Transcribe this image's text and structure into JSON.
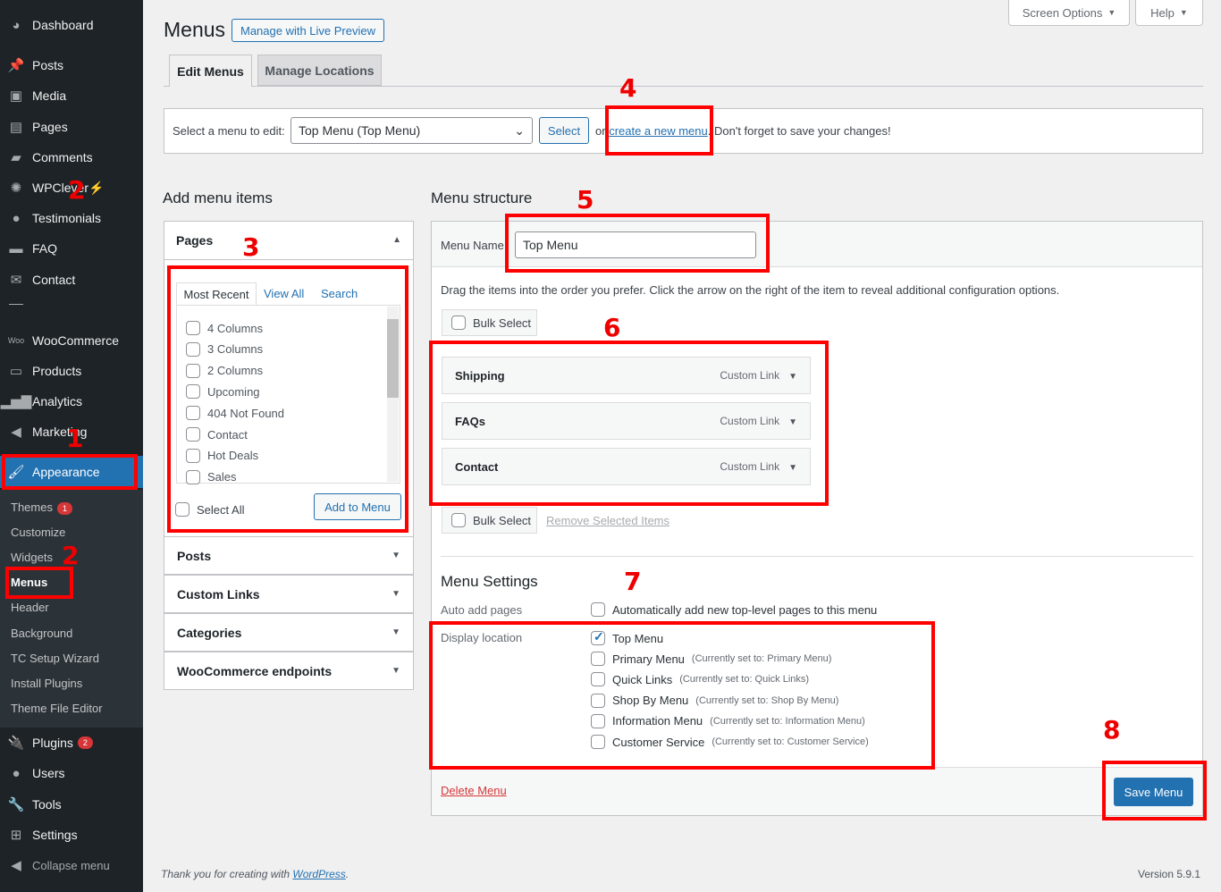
{
  "sidebar": {
    "items": [
      {
        "label": "Dashboard",
        "icon": "dashboard-icon"
      },
      {
        "label": "Posts",
        "icon": "pin-icon"
      },
      {
        "label": "Media",
        "icon": "media-icon"
      },
      {
        "label": "Pages",
        "icon": "pages-icon"
      },
      {
        "label": "Comments",
        "icon": "comment-icon"
      },
      {
        "label": "WPClever",
        "icon": "bulb-icon"
      },
      {
        "label": "Testimonials",
        "icon": "user-icon"
      },
      {
        "label": "FAQ",
        "icon": "folder-icon"
      },
      {
        "label": "Contact",
        "icon": "mail-icon"
      },
      {
        "label": "WooCommerce",
        "icon": "woo-icon"
      },
      {
        "label": "Products",
        "icon": "archive-icon"
      },
      {
        "label": "Analytics",
        "icon": "chart-icon"
      },
      {
        "label": "Marketing",
        "icon": "megaphone-icon"
      },
      {
        "label": "Appearance",
        "icon": "brush-icon"
      },
      {
        "label": "Plugins",
        "icon": "plugin-icon",
        "badge": "2"
      },
      {
        "label": "Users",
        "icon": "user-icon"
      },
      {
        "label": "Tools",
        "icon": "wrench-icon"
      },
      {
        "label": "Settings",
        "icon": "settings-icon"
      },
      {
        "label": "Collapse menu",
        "icon": "collapse-icon"
      }
    ],
    "submenu": [
      {
        "label": "Themes",
        "badge": "1"
      },
      {
        "label": "Customize"
      },
      {
        "label": "Widgets"
      },
      {
        "label": "Menus"
      },
      {
        "label": "Header"
      },
      {
        "label": "Background"
      },
      {
        "label": "TC Setup Wizard"
      },
      {
        "label": "Install Plugins"
      },
      {
        "label": "Theme File Editor"
      }
    ],
    "wpclever_bolt": "⚡"
  },
  "header": {
    "title": "Menus",
    "live_preview": "Manage with Live Preview",
    "screen_options": "Screen Options",
    "help": "Help",
    "tabs": [
      "Edit Menus",
      "Manage Locations"
    ]
  },
  "select_bar": {
    "label": "Select a menu to edit:",
    "selected": "Top Menu (Top Menu)",
    "select_btn": "Select",
    "or": "or",
    "create_link": "create a new menu",
    "tail": ". Don't forget to save your changes!"
  },
  "add_items": {
    "title": "Add menu items",
    "pages": {
      "title": "Pages",
      "tabs": [
        "Most Recent",
        "View All",
        "Search"
      ],
      "items": [
        "4 Columns",
        "3 Columns",
        "2 Columns",
        "Upcoming",
        "404 Not Found",
        "Contact",
        "Hot Deals",
        "Sales"
      ],
      "select_all": "Select All",
      "add_btn": "Add to Menu"
    },
    "sections": [
      "Posts",
      "Custom Links",
      "Categories",
      "WooCommerce endpoints"
    ]
  },
  "structure": {
    "title": "Menu structure",
    "name_label": "Menu Name",
    "name_value": "Top Menu",
    "hint": "Drag the items into the order you prefer. Click the arrow on the right of the item to reveal additional configuration options.",
    "bulk_select": "Bulk Select",
    "remove_selected": "Remove Selected Items",
    "items": [
      {
        "title": "Shipping",
        "type": "Custom Link"
      },
      {
        "title": "FAQs",
        "type": "Custom Link"
      },
      {
        "title": "Contact",
        "type": "Custom Link"
      }
    ]
  },
  "settings": {
    "title": "Menu Settings",
    "auto_label": "Auto add pages",
    "auto_text": "Automatically add new top-level pages to this menu",
    "display_label": "Display location",
    "locations": [
      {
        "name": "Top Menu",
        "note": "",
        "checked": true
      },
      {
        "name": "Primary Menu",
        "note": "(Currently set to: Primary Menu)"
      },
      {
        "name": "Quick Links",
        "note": "(Currently set to: Quick Links)"
      },
      {
        "name": "Shop By Menu",
        "note": "(Currently set to: Shop By Menu)"
      },
      {
        "name": "Information Menu",
        "note": "(Currently set to: Information Menu)"
      },
      {
        "name": "Customer Service",
        "note": "(Currently set to: Customer Service)"
      }
    ]
  },
  "footer_bar": {
    "delete": "Delete Menu",
    "save": "Save Menu"
  },
  "footer": {
    "thanks": "Thank you for creating with ",
    "wp": "WordPress",
    "period": ".",
    "version": "Version 5.9.1"
  },
  "annotations": [
    "1",
    "2",
    "2",
    "3",
    "4",
    "5",
    "6",
    "7",
    "8"
  ],
  "colors": {
    "accent": "#2271b1",
    "annotation": "#ff0000",
    "sidebar": "#1d2327"
  }
}
